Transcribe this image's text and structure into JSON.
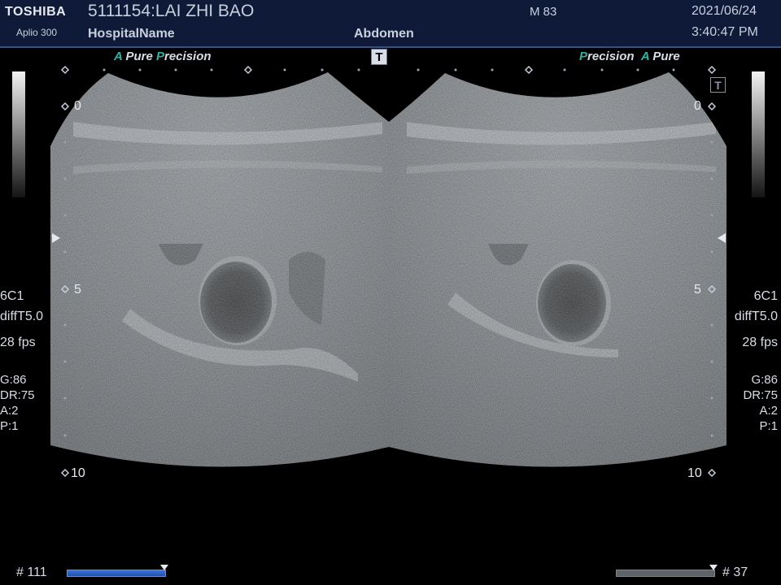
{
  "header": {
    "brand": "TOSHIBA",
    "model": "Aplio 300",
    "patient": "5111154:LAI ZHI BAO",
    "hospital": "HospitalName",
    "exam": "Abdomen",
    "age_sex": "M 83",
    "date": "2021/06/24",
    "time": "3:40:47 PM"
  },
  "overlay": {
    "apure_a": "A",
    "apure_text": "Pure",
    "precision_p": "P",
    "precision_text": "recision",
    "t_mark": "T"
  },
  "left_params": {
    "probe": "6C1",
    "mode": "diffT5.0",
    "fps": "28 fps",
    "gain": "G:86",
    "dr": "DR:75",
    "a": "A:2",
    "p": "P:1"
  },
  "right_params": {
    "probe": "6C1",
    "mode": "diffT5.0",
    "fps": "28 fps",
    "gain": "G:86",
    "dr": "DR:75",
    "a": "A:2",
    "p": "P:1"
  },
  "depth": {
    "d0": "0",
    "d5": "5",
    "d10": "10"
  },
  "frames": {
    "left_label": "# 111",
    "right_label": "# 37",
    "left_progress": 1.0,
    "right_progress": 1.0
  },
  "colors": {
    "header_bg": "#0e1a38",
    "accent_teal": "#2fb3a5",
    "progress_blue": "#2a62c8"
  }
}
